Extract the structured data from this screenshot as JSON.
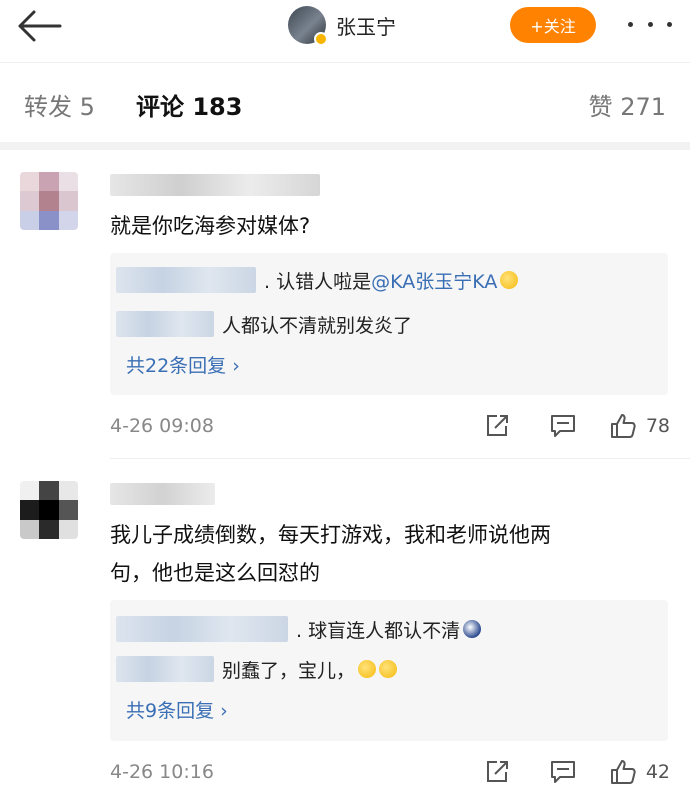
{
  "header": {
    "user_name": "张玉宁",
    "follow_label": "+关注"
  },
  "tabs": {
    "repost_label": "转发",
    "repost_count": "5",
    "comments_label": "评论",
    "comments_count": "183",
    "likes_label": "赞",
    "likes_count": "271"
  },
  "comments": [
    {
      "text": "就是你吃海参对媒体?",
      "replies": [
        {
          "prefix": ". 认错人啦是",
          "mention": "@KA张玉宁KA",
          "emoji": "laughing-tears"
        },
        {
          "prefix": "",
          "text": "人都认不清就别发炎了"
        }
      ],
      "more_replies": "共22条回复 ›",
      "time": "4-26 09:08",
      "likes": "78"
    },
    {
      "text_line1": "我儿子成绩倒数，每天打游戏，我和老师说他两",
      "text_line2": "句，他也是这么回怼的",
      "replies": [
        {
          "prefix": ". 球盲连人都认不清",
          "emoji": "dizzy-face"
        },
        {
          "prefix": "",
          "text": "别蠢了，宝儿，",
          "emoji": "smiling-face"
        }
      ],
      "more_replies": "共9条回复 ›",
      "time": "4-26 10:16",
      "likes": "42"
    }
  ],
  "colors": {
    "accent": "#ff8200",
    "link": "#3a6fb5"
  }
}
